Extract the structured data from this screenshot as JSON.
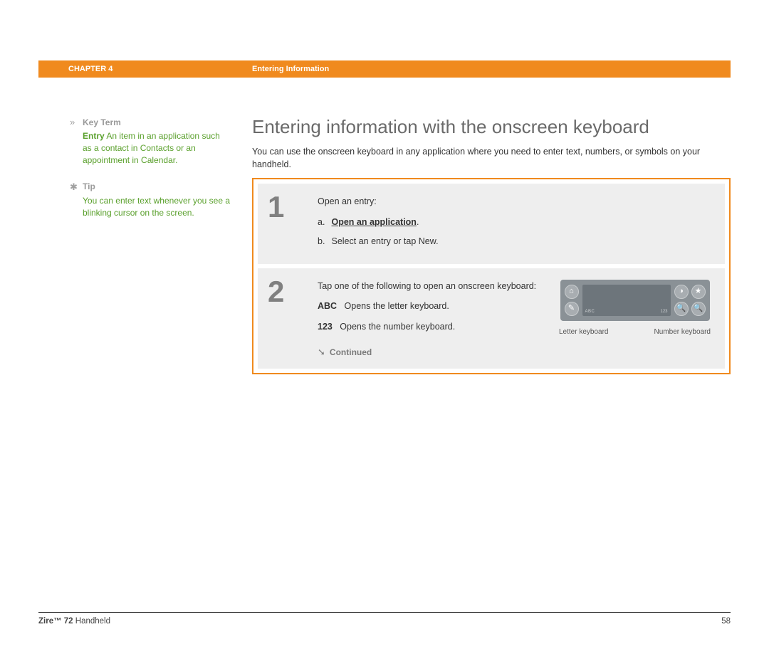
{
  "header": {
    "chapter": "CHAPTER 4",
    "section": "Entering Information"
  },
  "sidebar": {
    "keyterm": {
      "icon": "»",
      "label": "Key Term",
      "term": "Entry",
      "def_prefix": "   An item in an application such as a contact in Contacts or an appointment in Calendar."
    },
    "tip": {
      "icon": "✱",
      "label": "Tip",
      "text": "You can enter text whenever you see a blinking cursor on the screen."
    }
  },
  "main": {
    "title": "Entering information with the onscreen keyboard",
    "lead": "You can use the onscreen keyboard in any application where you need to enter text, numbers, or symbols on your handheld."
  },
  "steps": {
    "s1": {
      "num": "1",
      "intro": "Open an entry:",
      "a_label": "a.",
      "a_text": "Open an application",
      "a_period": ".",
      "b_label": "b.",
      "b_text": "Select an entry or tap New."
    },
    "s2": {
      "num": "2",
      "intro": "Tap one of the following to open an onscreen keyboard:",
      "abc_label": "ABC",
      "abc_text": "Opens the letter keyboard.",
      "n123_label": "123",
      "n123_text": "Opens the number keyboard.",
      "device": {
        "abc": "ABC",
        "n123": "123",
        "left_caption": "Letter keyboard",
        "right_caption": "Number keyboard"
      },
      "continued_icon": "➘",
      "continued": "Continued"
    }
  },
  "footer": {
    "product_bold": "Zire™ 72",
    "product_rest": " Handheld",
    "page": "58"
  },
  "icons": {
    "home": "⌂",
    "pen": "✎",
    "clock": "◑",
    "star": "★",
    "search": "🔍"
  }
}
